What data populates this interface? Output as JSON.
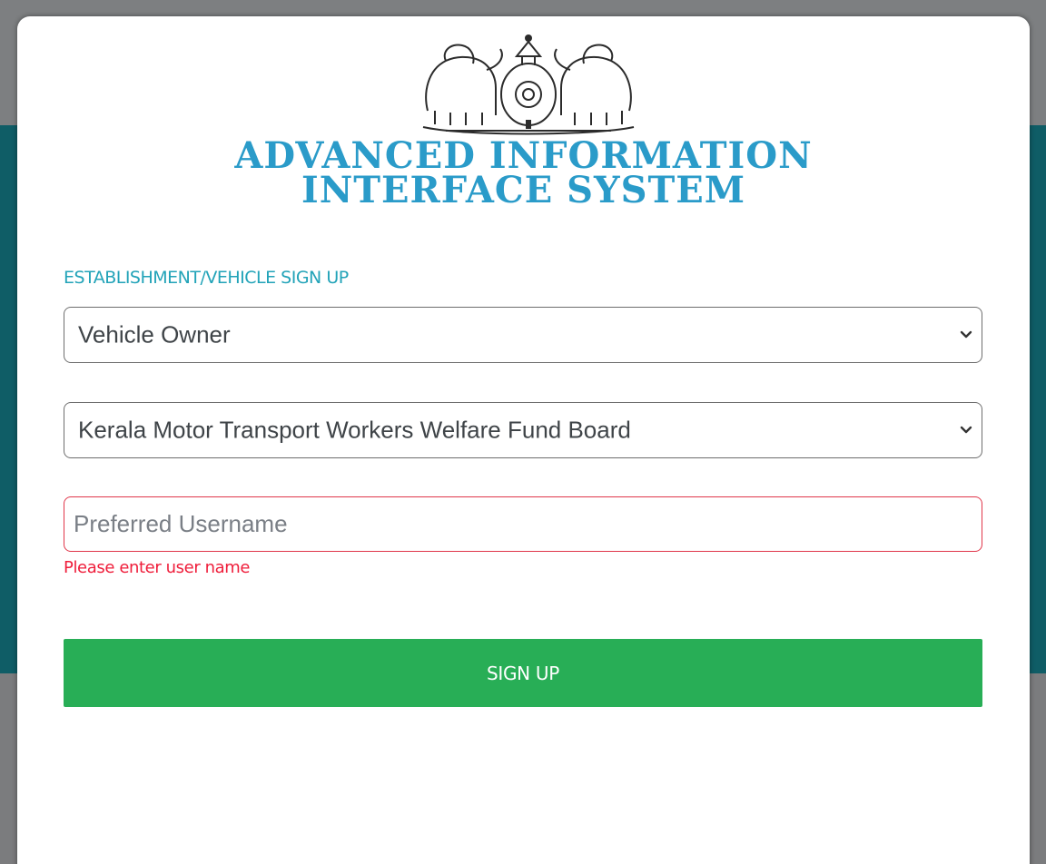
{
  "logo": {
    "line1": "ADVANCED INFORMATION",
    "line2": "INTERFACE SYSTEM"
  },
  "form": {
    "heading": "ESTABLISHMENT/VEHICLE SIGN UP",
    "user_type_select": {
      "selected": "Vehicle Owner"
    },
    "board_select": {
      "selected": "Kerala Motor Transport Workers Welfare Fund Board"
    },
    "username_input": {
      "value": "",
      "placeholder": "Preferred Username"
    },
    "username_error": "Please enter user name",
    "submit_label": "SIGN UP"
  },
  "colors": {
    "backdrop_band": "#0f5d66",
    "logo_text": "#2a9bc9",
    "heading": "#22a3b8",
    "error": "#ef1d3a",
    "button": "#28ae56"
  },
  "icons": {
    "emblem": "kerala-state-emblem-icon",
    "select_arrow": "chevron-down-icon"
  }
}
